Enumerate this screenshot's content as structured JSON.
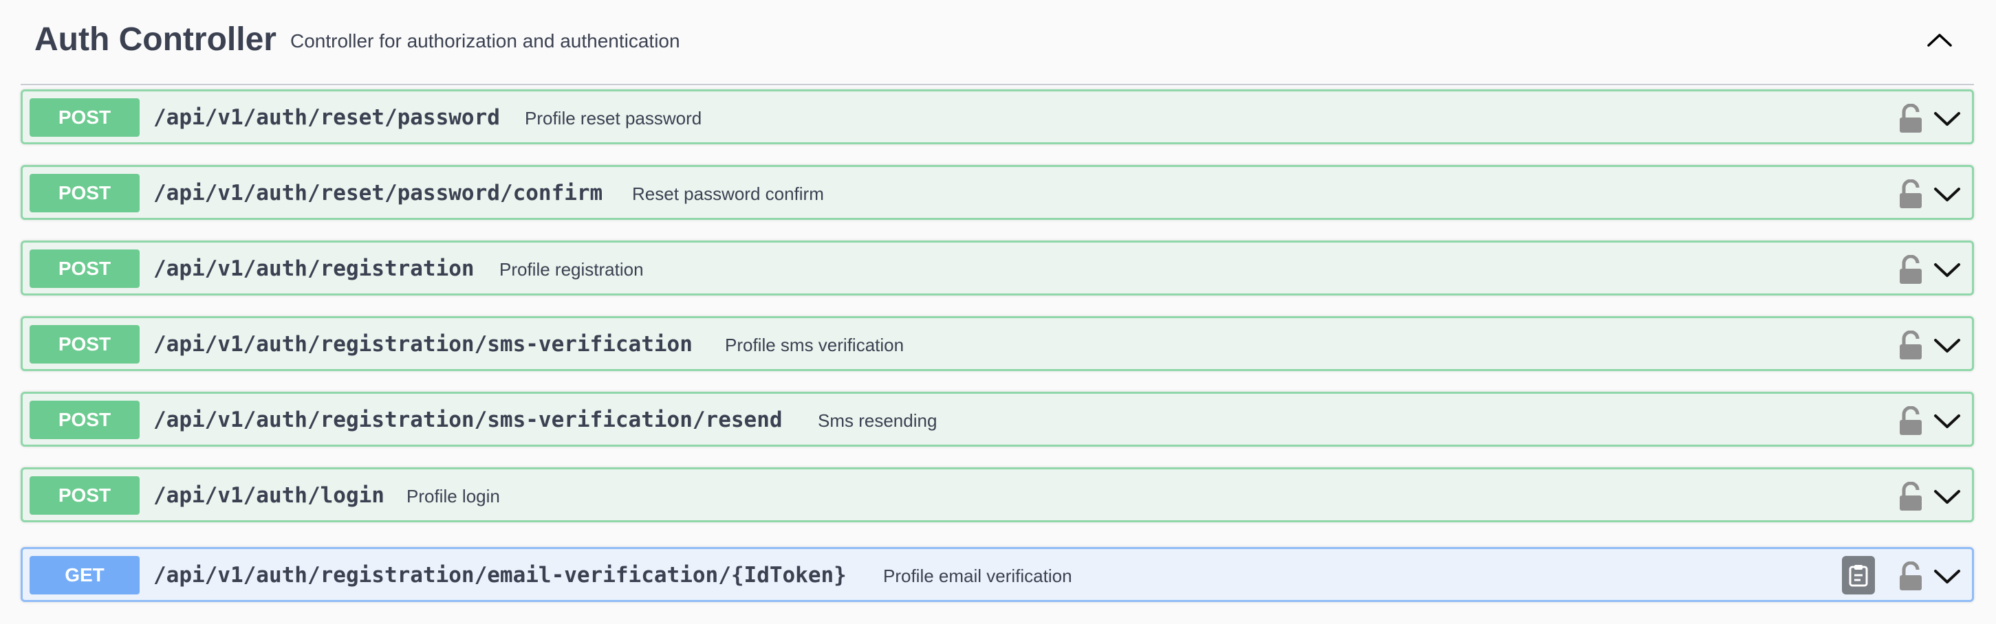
{
  "tag": {
    "name": "Auth Controller",
    "description": "Controller for authorization and authentication"
  },
  "icons": {
    "collapse": "chevron-up-icon",
    "lock": "unlocked-lock-icon",
    "expand": "chevron-down-icon",
    "copy": "clipboard-copy-icon"
  },
  "colors": {
    "post_badge": "#6ccb90",
    "post_border": "#8fd7a9",
    "post_bg": "#ecf4ef",
    "get_badge": "#74acf7",
    "get_border": "#8fbcf7",
    "get_bg": "#ebf2fb",
    "text": "#3b4151"
  },
  "operations": [
    {
      "method": "POST",
      "path": "/api/v1/auth/reset/password",
      "summary": "Profile reset password"
    },
    {
      "method": "POST",
      "path": "/api/v1/auth/reset/password/confirm",
      "summary": "Reset password confirm"
    },
    {
      "method": "POST",
      "path": "/api/v1/auth/registration",
      "summary": "Profile registration"
    },
    {
      "method": "POST",
      "path": "/api/v1/auth/registration/sms-verification",
      "summary": "Profile sms verification"
    },
    {
      "method": "POST",
      "path": "/api/v1/auth/registration/sms-verification/resend",
      "summary": "Sms resending"
    },
    {
      "method": "POST",
      "path": "/api/v1/auth/login",
      "summary": "Profile login"
    },
    {
      "method": "GET",
      "path": "/api/v1/auth/registration/email-verification/{IdToken}",
      "summary": "Profile email verification"
    }
  ]
}
